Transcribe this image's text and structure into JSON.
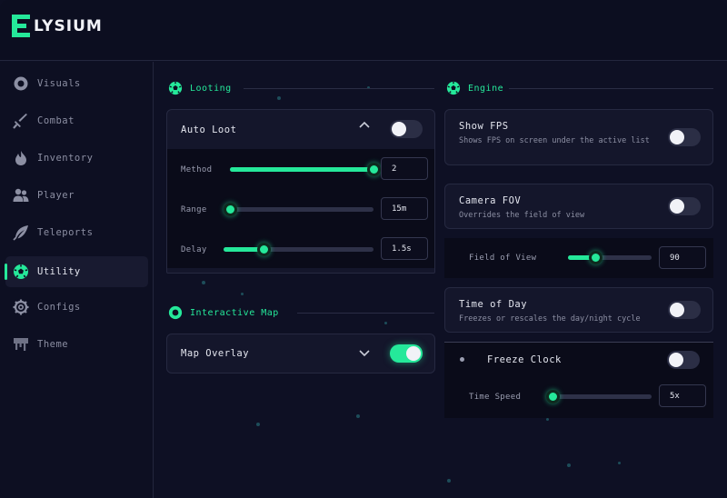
{
  "app": {
    "title": "LYSIUM"
  },
  "colors": {
    "accent": "#25e89a",
    "bg": "#0e1024",
    "card": "#14162b"
  },
  "sidebar": {
    "items": [
      {
        "label": "Visuals",
        "icon": "eye-ring-icon"
      },
      {
        "label": "Combat",
        "icon": "sword-icon"
      },
      {
        "label": "Inventory",
        "icon": "flame-icon"
      },
      {
        "label": "Player",
        "icon": "users-icon"
      },
      {
        "label": "Teleports",
        "icon": "feather-icon"
      },
      {
        "label": "Utility",
        "icon": "soccer-ball-icon",
        "active": true
      },
      {
        "label": "Configs",
        "icon": "gear-icon"
      },
      {
        "label": "Theme",
        "icon": "paint-drip-icon"
      }
    ]
  },
  "looting": {
    "title": "Looting",
    "auto_loot": {
      "label": "Auto Loot",
      "enabled": false,
      "expanded": true
    },
    "method": {
      "label": "Method",
      "value": "2",
      "fraction": 1.0
    },
    "range": {
      "label": "Range",
      "value": "15m",
      "fraction": 0.0
    },
    "delay": {
      "label": "Delay",
      "value": "1.5s",
      "fraction": 0.27
    }
  },
  "interactive_map": {
    "title": "Interactive Map",
    "map_overlay": {
      "label": "Map Overlay",
      "enabled": true,
      "expanded": false
    }
  },
  "engine": {
    "title": "Engine",
    "show_fps": {
      "label": "Show FPS",
      "desc": "Shows FPS on screen under the active list",
      "enabled": false
    },
    "camera_fov": {
      "label": "Camera FOV",
      "desc": "Overrides the field of view",
      "enabled": false
    },
    "field_of_view": {
      "label": "Field of View",
      "value": "90",
      "fraction": 0.33
    },
    "time_of_day": {
      "label": "Time of Day",
      "desc": "Freezes or rescales the day/night cycle",
      "enabled": false
    },
    "freeze_clock": {
      "label": "Freeze Clock",
      "enabled": false
    },
    "time_speed": {
      "label": "Time Speed",
      "value": "5x",
      "fraction": 0.04
    }
  }
}
